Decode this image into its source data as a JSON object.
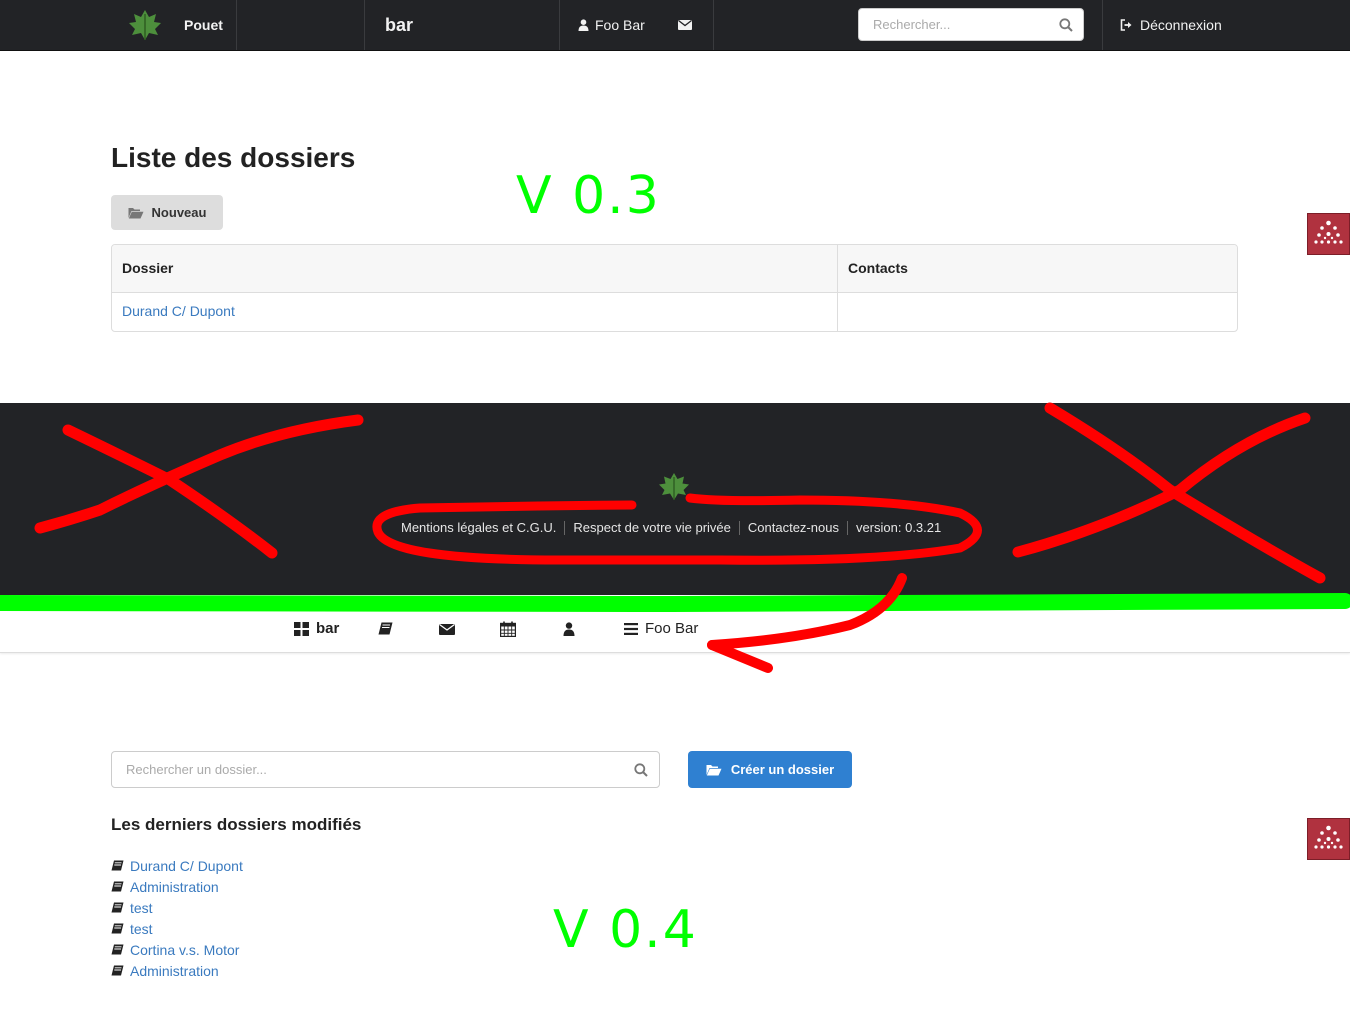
{
  "top_nav": {
    "brand": "Pouet",
    "app_title": "bar",
    "user": "Foo Bar",
    "search_placeholder": "Rechercher...",
    "logout": "Déconnexion"
  },
  "v03": {
    "heading": "Liste des dossiers",
    "new_button": "Nouveau",
    "table": {
      "columns": [
        "Dossier",
        "Contacts"
      ],
      "rows": [
        [
          "Durand C/ Dupont",
          ""
        ]
      ]
    }
  },
  "footer": {
    "links": [
      "Mentions légales et C.G.U.",
      "Respect de votre vie privée",
      "Contactez-nous",
      "version: 0.3.21"
    ]
  },
  "v04": {
    "nav": {
      "app_title": "bar",
      "user": "Foo Bar"
    },
    "search_placeholder": "Rechercher un dossier...",
    "create_button": "Créer un dossier",
    "recent_heading": "Les derniers dossiers modifiés",
    "recent": [
      "Durand C/ Dupont",
      "Administration",
      "test",
      "test",
      "Cortina v.s. Motor",
      "Administration"
    ]
  },
  "annotations": {
    "label_v03": "V 0.3",
    "label_v04": "V 0.4",
    "color": "#00ff00",
    "mark_color": "#ff0000"
  },
  "colors": {
    "navbar": "#222326",
    "link": "#3a7abf",
    "primary": "#2f80d1",
    "widget": "#b0323f"
  }
}
